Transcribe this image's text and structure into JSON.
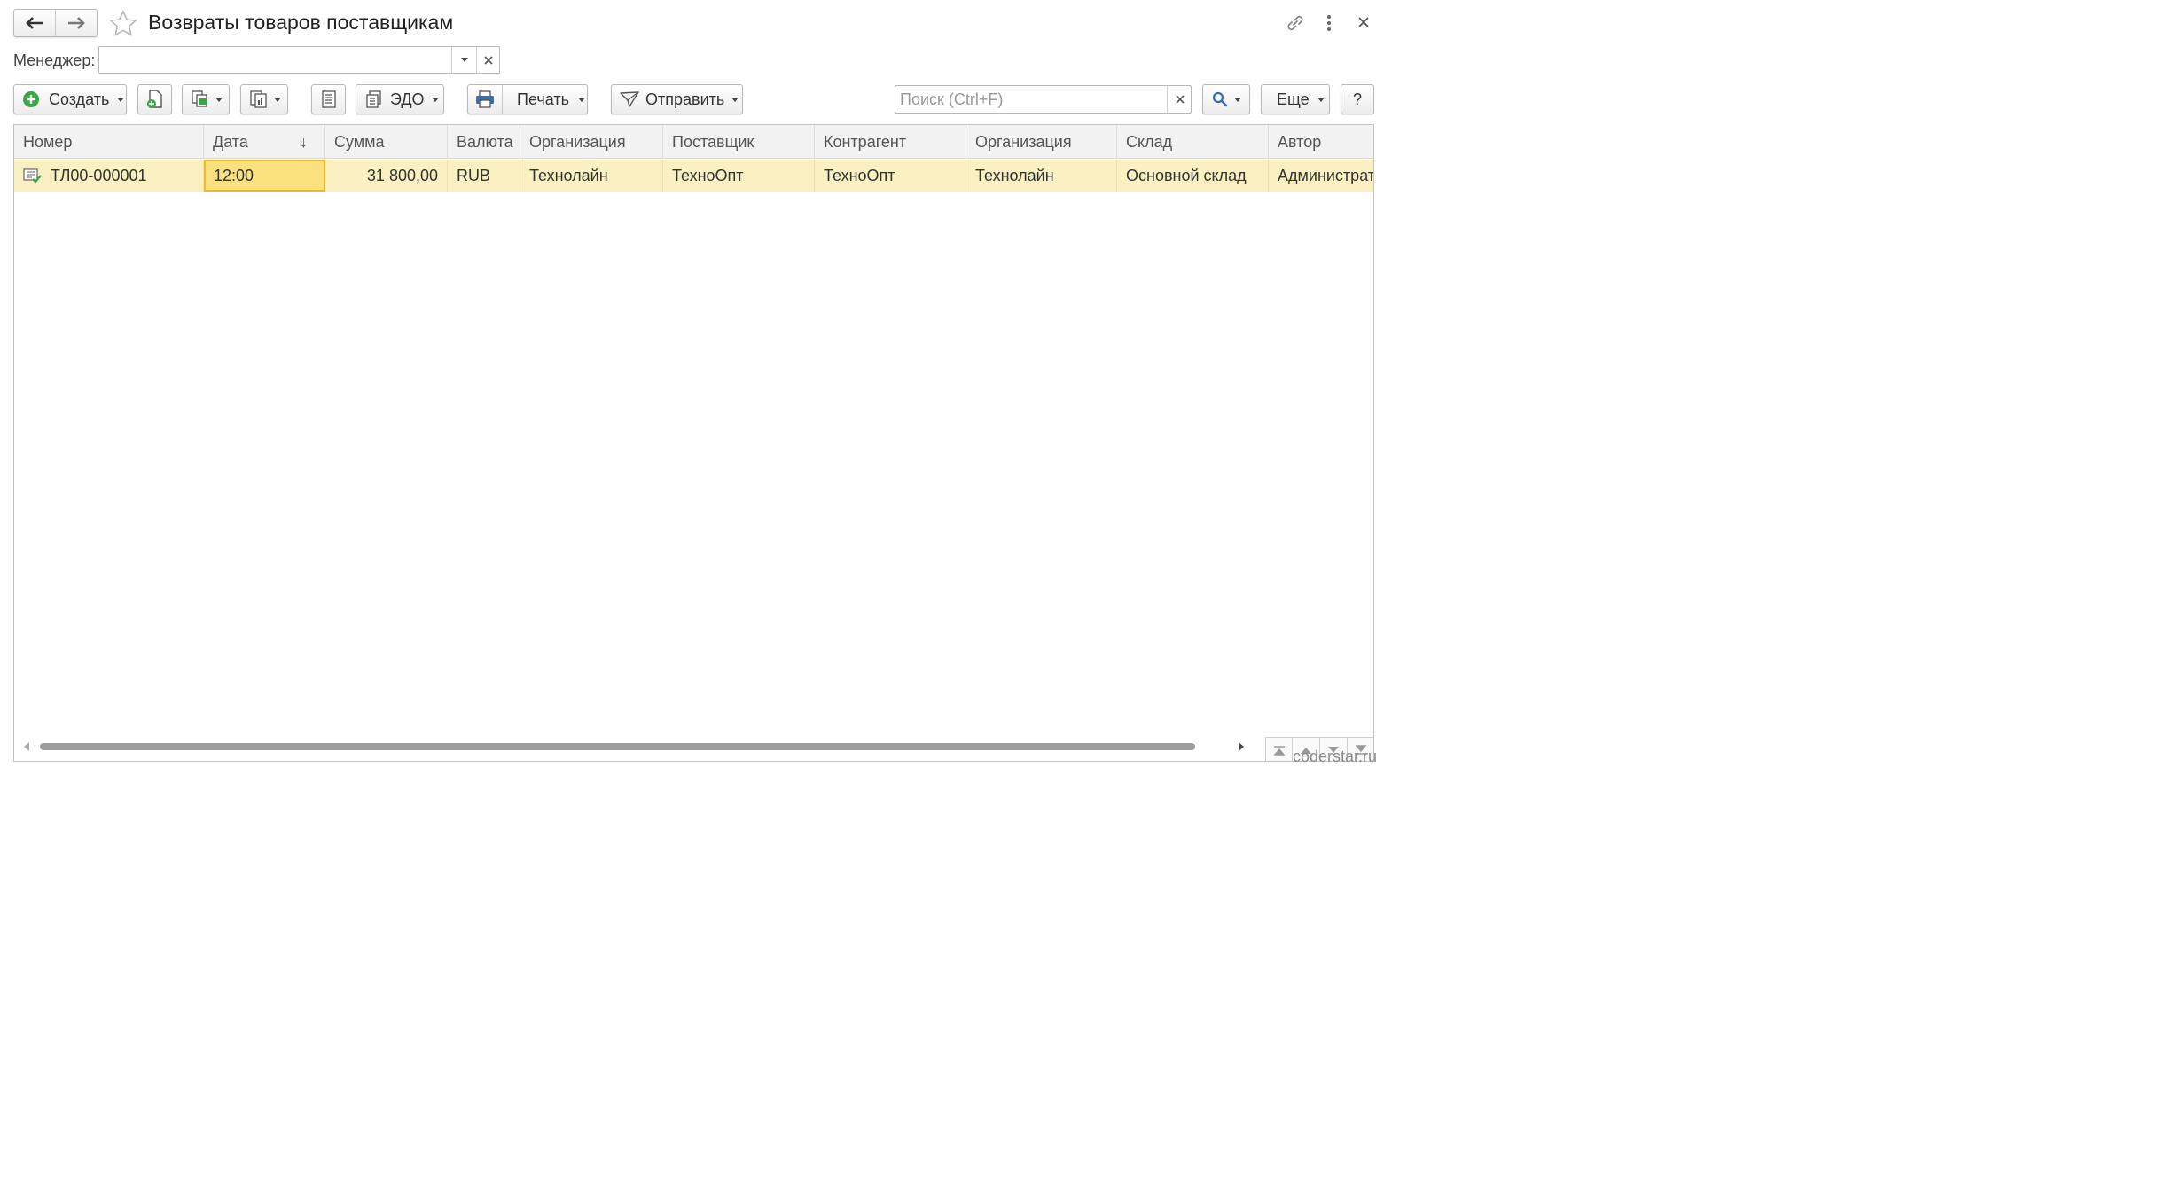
{
  "window": {
    "title": "Возвраты товаров поставщикам"
  },
  "filter": {
    "manager_label": "Менеджер:",
    "manager_value": ""
  },
  "toolbar": {
    "create_label": "Создать",
    "edo_label": "ЭДО",
    "print_label": "Печать",
    "send_label": "Отправить",
    "search_placeholder": "Поиск (Ctrl+F)",
    "more_label": "Еще",
    "help_label": "?"
  },
  "table": {
    "columns": [
      "Номер",
      "Дата",
      "Сумма",
      "Валюта",
      "Организация",
      "Поставщик",
      "Контрагент",
      "Организация",
      "Склад",
      "Автор"
    ],
    "sort_indicator": "↓",
    "rows": [
      {
        "number": "ТЛ00-000001",
        "date": "12:00",
        "sum": "31 800,00",
        "currency": "RUB",
        "organization": "Технолайн",
        "supplier": "ТехноОпт",
        "counterparty": "ТехноОпт",
        "organization2": "Технолайн",
        "warehouse": "Основной склад",
        "author": "Администратор"
      }
    ]
  },
  "watermark": "coderstar.ru",
  "colors": {
    "selected_row": "#fbf0c2",
    "selected_cell": "#fbe17e",
    "selected_cell_border": "#f0b72f",
    "create_icon": "#3aa645"
  }
}
